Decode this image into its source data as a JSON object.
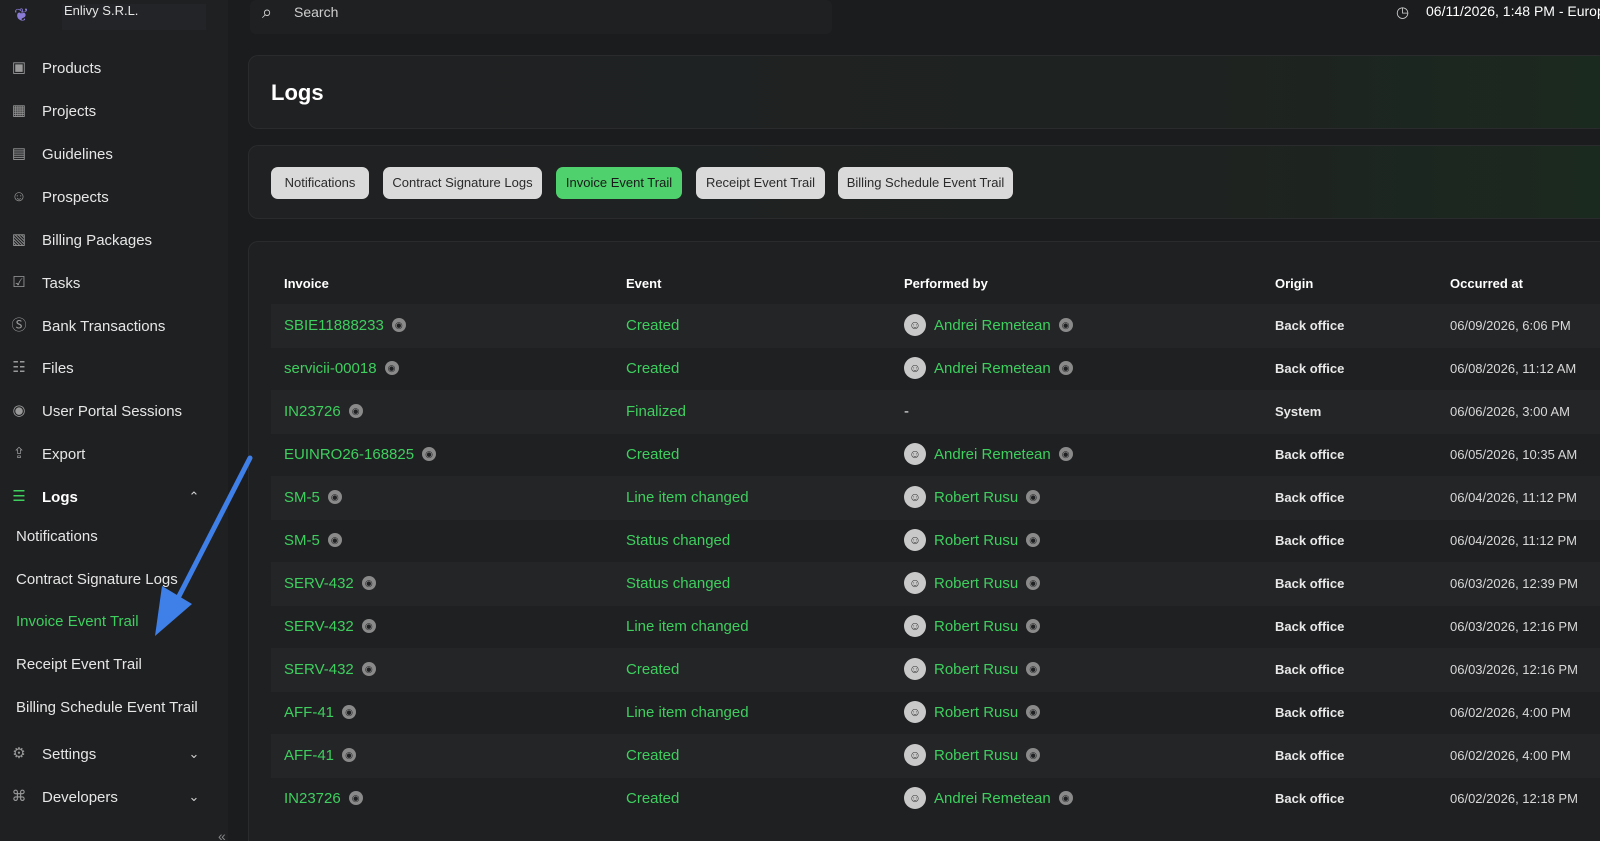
{
  "org": {
    "name": "Enlivy S.R.L.",
    "logo_icon": "dragon-logo-icon"
  },
  "sidebar": {
    "items": [
      {
        "label": "Products",
        "icon": "box-icon"
      },
      {
        "label": "Projects",
        "icon": "grid-icon"
      },
      {
        "label": "Guidelines",
        "icon": "book-icon"
      },
      {
        "label": "Prospects",
        "icon": "users-icon"
      },
      {
        "label": "Billing Packages",
        "icon": "package-icon"
      },
      {
        "label": "Tasks",
        "icon": "tasks-icon"
      },
      {
        "label": "Bank Transactions",
        "icon": "bank-icon"
      },
      {
        "label": "Files",
        "icon": "file-icon"
      },
      {
        "label": "User Portal Sessions",
        "icon": "portal-icon"
      },
      {
        "label": "Export",
        "icon": "export-icon"
      },
      {
        "label": "Logs",
        "icon": "logs-icon"
      },
      {
        "label": "Settings",
        "icon": "settings-icon"
      },
      {
        "label": "Developers",
        "icon": "developers-icon"
      }
    ],
    "logs_submenu": [
      "Notifications",
      "Contract Signature Logs",
      "Invoice Event Trail",
      "Receipt Event Trail",
      "Billing Schedule Event Trail"
    ],
    "current_submenu": "Invoice Event Trail"
  },
  "topbar": {
    "search_placeholder": "Search",
    "datetime": "06/11/2026, 1:48 PM  -  Europ"
  },
  "page": {
    "title": "Logs",
    "tabs": [
      "Notifications",
      "Contract Signature Logs",
      "Invoice Event Trail",
      "Receipt Event Trail",
      "Billing Schedule Event Trail"
    ],
    "active_tab": "Invoice Event Trail"
  },
  "table": {
    "headers": [
      "Invoice",
      "Event",
      "Performed by",
      "Origin",
      "Occurred at"
    ],
    "rows": [
      {
        "invoice": "SBIE11888233",
        "event": "Created",
        "performed_by": "Andrei Remetean",
        "origin": "Back office",
        "occurred_at": "06/09/2026, 6:06 PM"
      },
      {
        "invoice": "servicii-00018",
        "event": "Created",
        "performed_by": "Andrei Remetean",
        "origin": "Back office",
        "occurred_at": "06/08/2026, 11:12 AM"
      },
      {
        "invoice": "IN23726",
        "event": "Finalized",
        "performed_by": "-",
        "origin": "System",
        "occurred_at": "06/06/2026, 3:00 AM"
      },
      {
        "invoice": "EUINRO26-168825",
        "event": "Created",
        "performed_by": "Andrei Remetean",
        "origin": "Back office",
        "occurred_at": "06/05/2026, 10:35 AM"
      },
      {
        "invoice": "SM-5",
        "event": "Line item changed",
        "performed_by": "Robert Rusu",
        "origin": "Back office",
        "occurred_at": "06/04/2026, 11:12 PM"
      },
      {
        "invoice": "SM-5",
        "event": "Status changed",
        "performed_by": "Robert Rusu",
        "origin": "Back office",
        "occurred_at": "06/04/2026, 11:12 PM"
      },
      {
        "invoice": "SERV-432",
        "event": "Status changed",
        "performed_by": "Robert Rusu",
        "origin": "Back office",
        "occurred_at": "06/03/2026, 12:39 PM"
      },
      {
        "invoice": "SERV-432",
        "event": "Line item changed",
        "performed_by": "Robert Rusu",
        "origin": "Back office",
        "occurred_at": "06/03/2026, 12:16 PM"
      },
      {
        "invoice": "SERV-432",
        "event": "Created",
        "performed_by": "Robert Rusu",
        "origin": "Back office",
        "occurred_at": "06/03/2026, 12:16 PM"
      },
      {
        "invoice": "AFF-41",
        "event": "Line item changed",
        "performed_by": "Robert Rusu",
        "origin": "Back office",
        "occurred_at": "06/02/2026, 4:00 PM"
      },
      {
        "invoice": "AFF-41",
        "event": "Created",
        "performed_by": "Robert Rusu",
        "origin": "Back office",
        "occurred_at": "06/02/2026, 4:00 PM"
      },
      {
        "invoice": "IN23726",
        "event": "Created",
        "performed_by": "Andrei Remetean",
        "origin": "Back office",
        "occurred_at": "06/02/2026, 12:18 PM"
      }
    ]
  },
  "colors": {
    "accent_green": "#3ecf5f",
    "annotation_arrow": "#3f7fe8"
  }
}
